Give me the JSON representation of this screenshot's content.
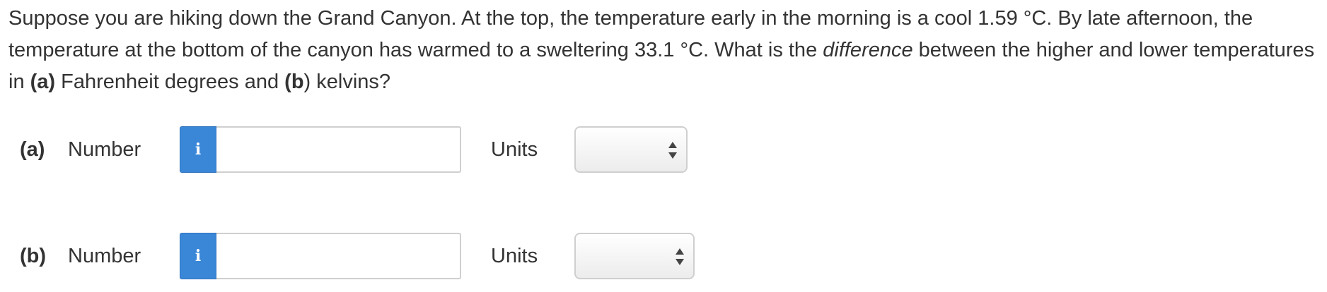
{
  "question": {
    "part1": "Suppose you are hiking down the Grand Canyon. At the top, the temperature early in the morning is a cool 1.59 °C. By late afternoon, the temperature at the bottom of the canyon has warmed to a sweltering 33.1 °C. What is the ",
    "emphasis": "difference",
    "part2": " between the higher and lower temperatures in ",
    "label_a": "(a)",
    "part3": " Fahrenheit degrees and ",
    "label_b": "(b",
    "part4": ") kelvins?"
  },
  "answers": [
    {
      "part_label": "(a)",
      "number_label": "Number",
      "info_glyph": "i",
      "number_value": "",
      "units_label": "Units",
      "units_selected": ""
    },
    {
      "part_label": "(b)",
      "number_label": "Number",
      "info_glyph": "i",
      "number_value": "",
      "units_label": "Units",
      "units_selected": ""
    }
  ],
  "colors": {
    "info_button": "#3a87d8",
    "text": "#333333",
    "input_border": "#cfcfcf"
  },
  "icons": {
    "info": "info-icon",
    "select_arrows": "up-down-arrows-icon"
  }
}
